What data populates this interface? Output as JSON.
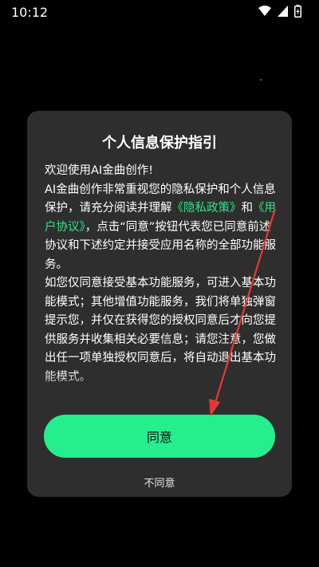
{
  "status_bar": {
    "time": "10:12"
  },
  "dialog": {
    "title": "个人信息保护指引",
    "intro": "欢迎使用AI金曲创作!",
    "p1_a": "AI金曲创作非常重视您的隐私保护和个人信息保护，请充分阅读并理解",
    "privacy_link": "《隐私政策》",
    "p1_and": "和",
    "user_link": "《用户协议》",
    "p1_b": "，点击“同意”按钮代表您已同意前述协议和下述约定并接受应用名称的全部功能服务。",
    "p2": "如您仅同意接受基本功能服务，可进入基本功能模式；其他增值功能服务，我们将单独弹窗提示您，并仅在获得您的授权同意后才向您提供服务并收集相关必要信息；请您注意，您做出任一项单独授权同意后，将自动退出基本功能模式。",
    "agree_label": "同意",
    "disagree_label": "不同意"
  },
  "colors": {
    "accent": "#25ee8e",
    "link": "#2ee68c",
    "dialog_bg": "#2e2e2e",
    "annotation": "#e53935"
  }
}
